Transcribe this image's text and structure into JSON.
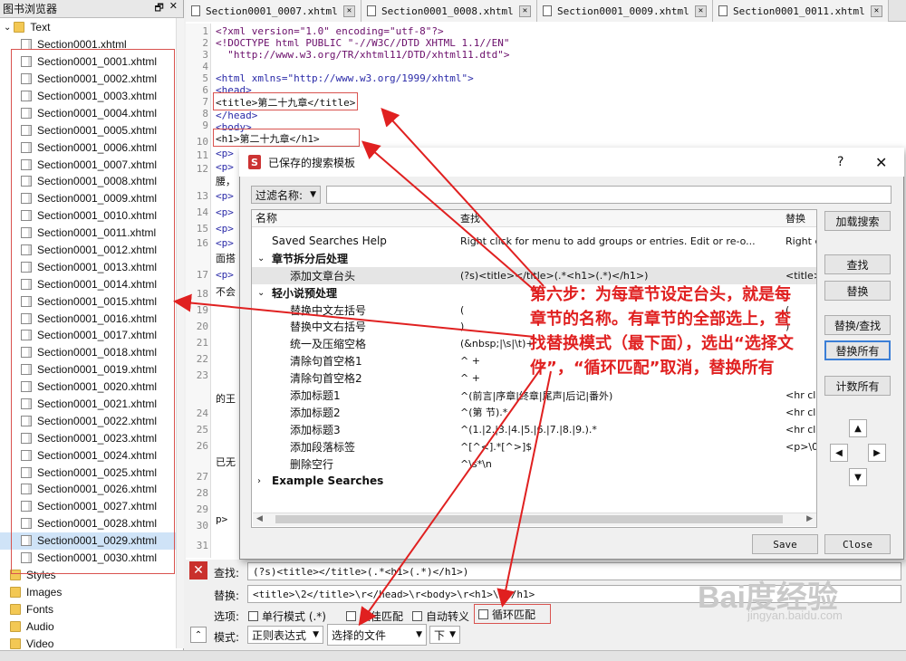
{
  "browser": {
    "title": "图书浏览器",
    "ctl_float": "🗗",
    "ctl_close": "✕",
    "root": "Text",
    "files": [
      "Section0001.xhtml",
      "Section0001_0001.xhtml",
      "Section0001_0002.xhtml",
      "Section0001_0003.xhtml",
      "Section0001_0004.xhtml",
      "Section0001_0005.xhtml",
      "Section0001_0006.xhtml",
      "Section0001_0007.xhtml",
      "Section0001_0008.xhtml",
      "Section0001_0009.xhtml",
      "Section0001_0010.xhtml",
      "Section0001_0011.xhtml",
      "Section0001_0012.xhtml",
      "Section0001_0013.xhtml",
      "Section0001_0014.xhtml",
      "Section0001_0015.xhtml",
      "Section0001_0016.xhtml",
      "Section0001_0017.xhtml",
      "Section0001_0018.xhtml",
      "Section0001_0019.xhtml",
      "Section0001_0020.xhtml",
      "Section0001_0021.xhtml",
      "Section0001_0022.xhtml",
      "Section0001_0023.xhtml",
      "Section0001_0024.xhtml",
      "Section0001_0025.xhtml",
      "Section0001_0026.xhtml",
      "Section0001_0027.xhtml",
      "Section0001_0028.xhtml",
      "Section0001_0029.xhtml",
      "Section0001_0030.xhtml"
    ],
    "folders": [
      "Styles",
      "Images",
      "Fonts",
      "Audio",
      "Video"
    ]
  },
  "tabs": [
    "Section0001_0007.xhtml",
    "Section0001_0008.xhtml",
    "Section0001_0009.xhtml",
    "Section0001_0011.xhtml"
  ],
  "tab_close": "✕",
  "code": {
    "l1": "<?xml version=\"1.0\" encoding=\"utf-8\"?>",
    "l2": "<!DOCTYPE html PUBLIC \"-//W3C//DTD XHTML 1.1//EN\"",
    "l3": "  \"http://www.w3.org/TR/xhtml11/DTD/xhtml11.dtd\">",
    "l5": "<html xmlns=\"http://www.w3.org/1999/xhtml\">",
    "l6": "<head>",
    "l7": "<title>第二十九章</title>",
    "l8": "</head>",
    "l9": "<body>",
    "l10": "<h1>第二十九章</h1>",
    "p": "<p>",
    "frag_12a": "腰，",
    "frag_16a": "面搭",
    "frag_17a": "不会",
    "frag_23a": "的王",
    "frag_26a": "已无",
    "frag_29a": "p>",
    "lines": [
      "1",
      "2",
      "3",
      "4",
      "5",
      "6",
      "7",
      "8",
      "9",
      "10",
      "11",
      "12",
      "13",
      "14",
      "15",
      "16",
      "17",
      "18",
      "19",
      "20",
      "21",
      "22",
      "23",
      "24",
      "25",
      "26",
      "27",
      "28",
      "29",
      "30",
      "31"
    ]
  },
  "dialog": {
    "title": "已保存的搜索模板",
    "help": "?",
    "close": "✕",
    "filter_label": "过滤名称:",
    "filter_value": "",
    "headers": [
      "名称",
      "查找",
      "替换"
    ],
    "rows": [
      {
        "name": "Saved Searches Help",
        "find": "Right click for menu to add groups or entries.  Edit or re-o...",
        "rep": "Right c"
      },
      {
        "name": "章节拆分后处理",
        "find": "",
        "rep": ""
      },
      {
        "name": "添加文章台头",
        "find": "(?s)<title></title>(.*<h1>(.*)</h1>)",
        "rep": "<title>"
      },
      {
        "name": "轻小说预处理",
        "find": "",
        "rep": ""
      },
      {
        "name": "替换中文左括号",
        "find": "(",
        "rep": "("
      },
      {
        "name": "替换中文右括号",
        "find": ")",
        "rep": ")"
      },
      {
        "name": "统一及压缩空格",
        "find": "(&nbsp;|\\s|\\t)+",
        "rep": ""
      },
      {
        "name": "清除句首空格1",
        "find": "^ +",
        "rep": ""
      },
      {
        "name": "清除句首空格2",
        "find": "^   +",
        "rep": ""
      },
      {
        "name": "添加标题1",
        "find": "^(前言|序章|终章|尾声|后记|番外)",
        "rep": "<hr cla"
      },
      {
        "name": "添加标题2",
        "find": "^(第 节).*",
        "rep": "<hr cla"
      },
      {
        "name": "添加标题3",
        "find": "^(1.|2.|3.|4.|5.|6.|7.|8.|9.).*",
        "rep": "<hr cla"
      },
      {
        "name": "添加段落标签",
        "find": "^[^<].*[^>]$",
        "rep": "<p>\\0"
      },
      {
        "name": "删除空行",
        "find": "^\\s*\\n",
        "rep": ""
      },
      {
        "name": "Example Searches",
        "find": "",
        "rep": ""
      }
    ],
    "buttons": {
      "load": "加载搜索",
      "find": "查找",
      "replace": "替换",
      "replace_find": "替换/查找",
      "replace_all": "替换所有",
      "count_all": "计数所有",
      "save": "Save",
      "close": "Close"
    }
  },
  "annotation": "第六步：为每章节设定台头，就是每章节的名称。有章节的全部选上，查找替换模式（最下面），选出“选择文件”，“循环匹配”取消，替换所有",
  "findbar": {
    "find_label": "查找:",
    "find_value": "(?s)<title></title>(.*<h1>(.*)</h1>)",
    "replace_label": "替换:",
    "replace_value": "<title>\\2</title>\\r</head>\\r<body>\\r<h1>\\2</h1>",
    "options_label": "选项:",
    "opt1": "单行模式 (.*)",
    "opt2": "最佳匹配",
    "opt3": "自动转义",
    "opt4": "循环匹配",
    "mode_label": "模式:",
    "mode_value": "正则表达式",
    "target_value": "选择的文件",
    "direction_value": "下"
  },
  "watermark": "Bai度经验",
  "watermark_sub": "jingyan.baidu.com",
  "colors": {
    "annotation": "#e02020",
    "selection": "#cfe3f7"
  }
}
